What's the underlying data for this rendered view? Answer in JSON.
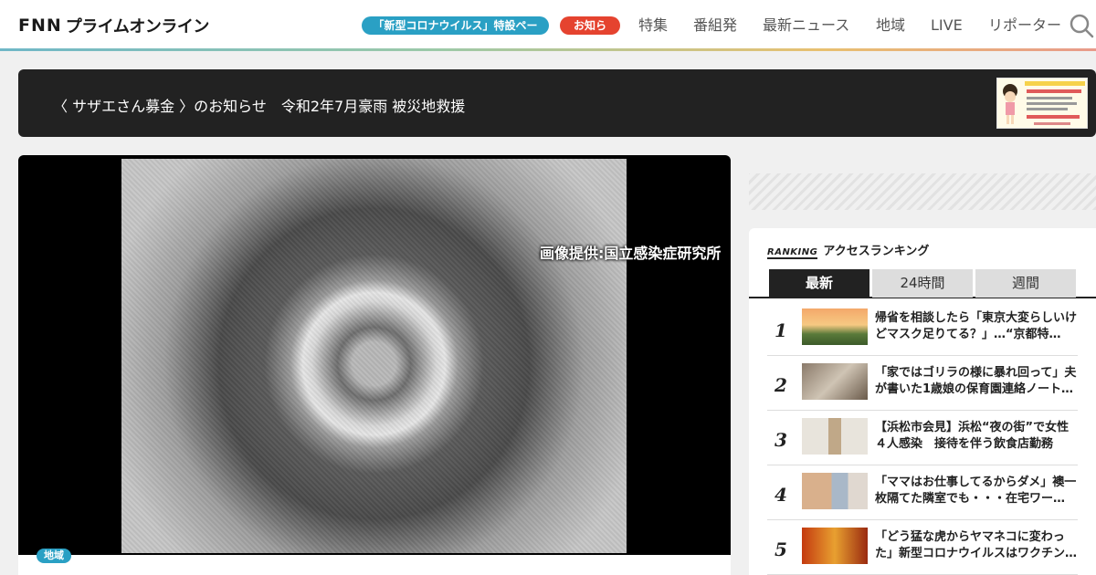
{
  "header": {
    "logo_fnn": "FNN",
    "logo_text": "プライムオンライン",
    "corona_pill": "「新型コロナウイルス」特設ページ",
    "notice_pill": "お知らせ",
    "nav": [
      "特集",
      "番組発",
      "最新ニュース",
      "地域",
      "LIVE",
      "リポーター"
    ],
    "search_icon": "search-icon"
  },
  "banner": {
    "part1": "〈 サザエさん募金 〉のお知らせ",
    "part2": "令和2年7月豪雨 被災地救援"
  },
  "hero": {
    "credit": "画像提供:国立感染症研究所",
    "tag": "地域"
  },
  "ranking": {
    "label_word": "RANKING",
    "label": "アクセスランキング",
    "tabs": [
      "最新",
      "24時間",
      "週間"
    ],
    "items": [
      {
        "rank": "1",
        "title": "帰省を相談したら「東京大変らしいけどマスク足りてる？」…“京都特…"
      },
      {
        "rank": "2",
        "title": "「家ではゴリラの様に暴れ回って」夫が書いた1歳娘の保育園連絡ノート…"
      },
      {
        "rank": "3",
        "title": "【浜松市会見】浜松“夜の街”で女性４人感染　接待を伴う飲食店勤務"
      },
      {
        "rank": "4",
        "title": "「ママはお仕事してるからダメ」襖一枚隔てた隣室でも・・・在宅ワー…"
      },
      {
        "rank": "5",
        "title": "「どう猛な虎からヤマネコに変わった」新型コロナウイルスはワクチン…"
      }
    ]
  },
  "colors": {
    "accent_blue": "#2aa0c4",
    "accent_red": "#e5432f",
    "dark": "#222222"
  }
}
